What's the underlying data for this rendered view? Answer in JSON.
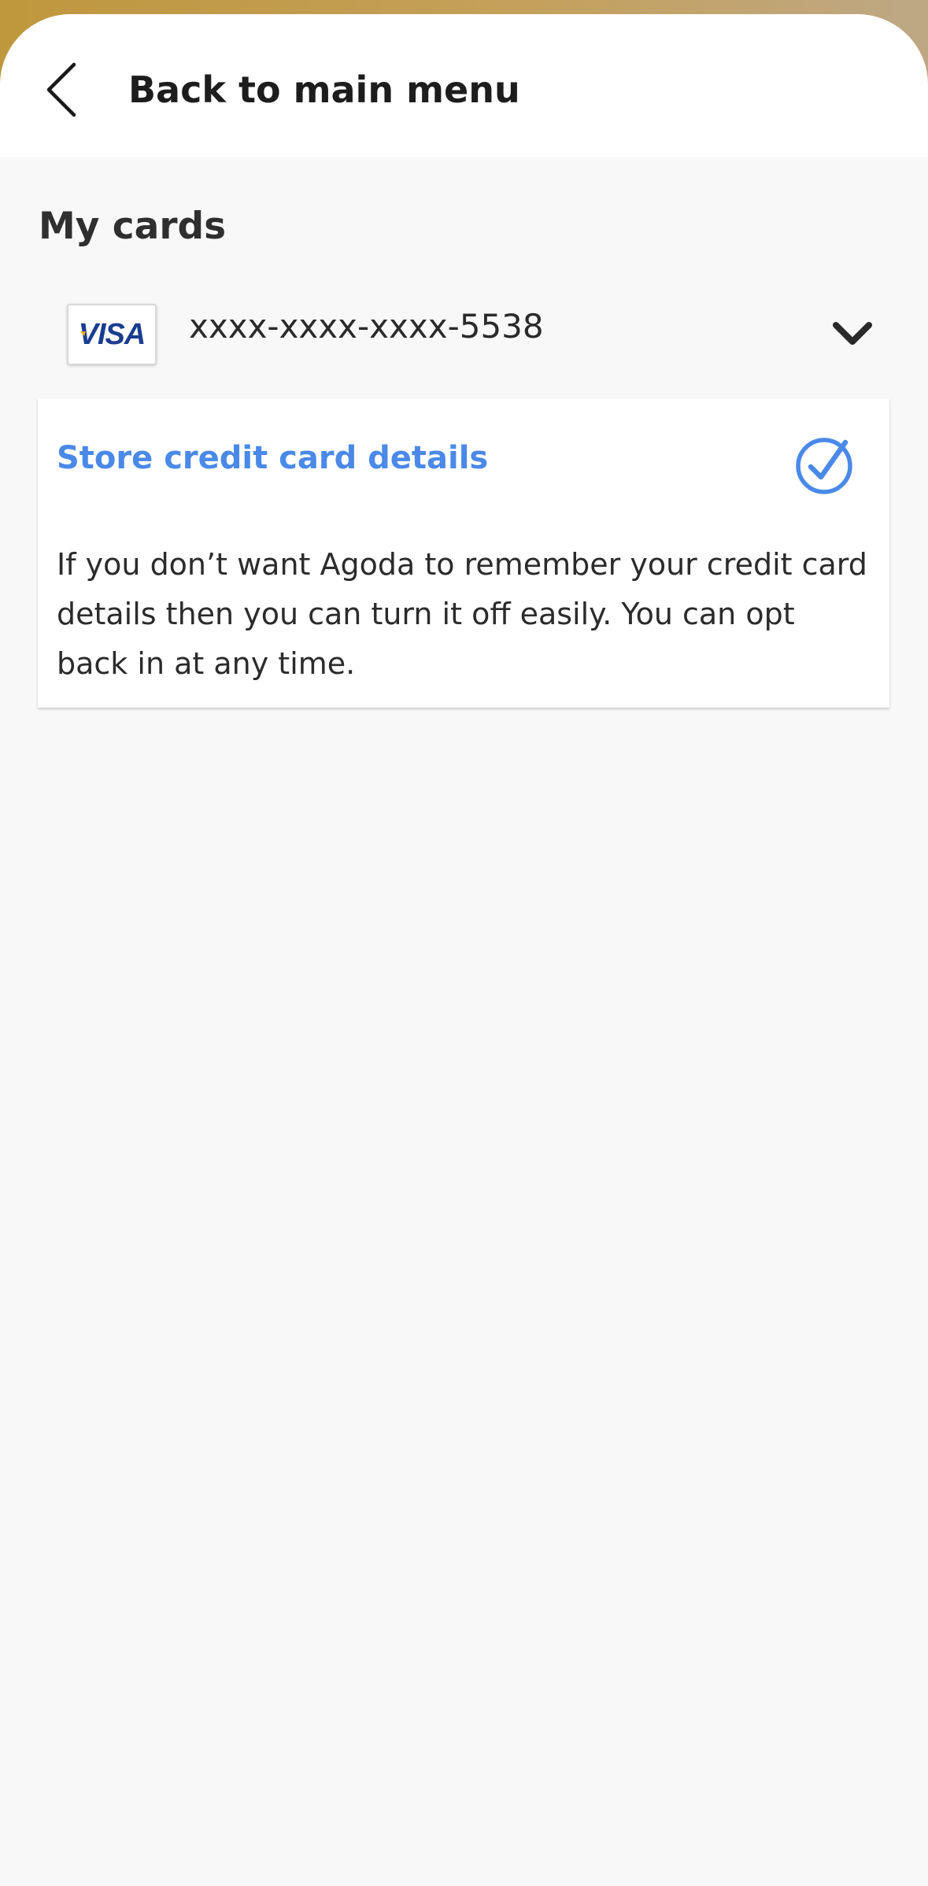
{
  "header": {
    "back_label": "Back to main menu"
  },
  "my_cards": {
    "title": "My cards",
    "card": {
      "brand": "VISA",
      "number": "xxxx-xxxx-xxxx-5538"
    }
  },
  "store": {
    "title": "Store credit card details",
    "enabled": true,
    "description": "If you don’t want Agoda to remember your credit card details then you can turn it off easily. You can opt back in at any time."
  },
  "colors": {
    "accent": "#4a89e8",
    "visa_blue": "#1a3d91",
    "visa_gold": "#f2a900"
  },
  "icons": {
    "back": "chevron-left-icon",
    "expand": "chevron-down-icon",
    "toggle": "check-circle-icon"
  }
}
